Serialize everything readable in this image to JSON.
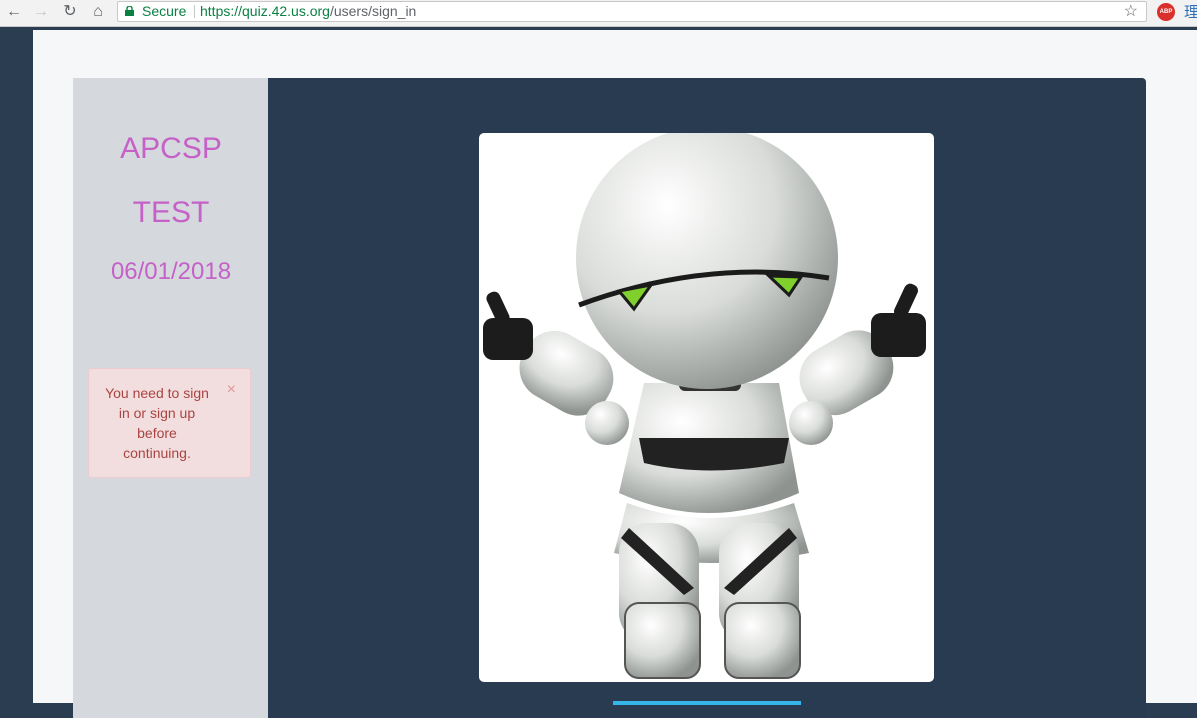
{
  "browser": {
    "secure_label": "Secure",
    "url_host": "https://quiz.42.us.org",
    "url_path": "/users/sign_in",
    "extension_label": "ABP",
    "extension2_label": "理"
  },
  "sidebar": {
    "title_line1": "APCSP",
    "title_line2": "TEST",
    "date": "06/01/2018"
  },
  "alert": {
    "message": "You need to sign in or sign up before continuing.",
    "close": "×"
  },
  "colors": {
    "sidebar_text": "#c561c7",
    "main_bg": "#283b51",
    "alert_bg": "#f2dede"
  }
}
